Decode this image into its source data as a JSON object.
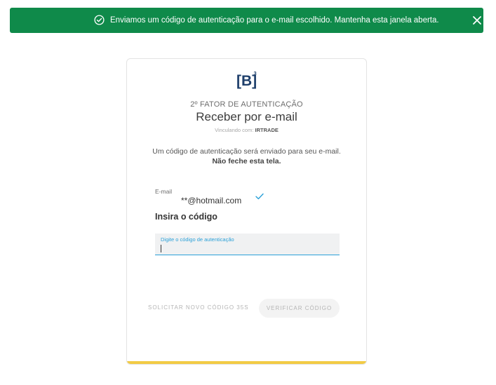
{
  "toast": {
    "message": "Enviamos um código de autenticação para o e-mail escolhido. Mantenha esta janela aberta.",
    "color": "#0f8a4a"
  },
  "logo": {
    "text": "[B]",
    "superscript": "3"
  },
  "header": {
    "subtitle": "2º FATOR DE AUTENTICAÇÃO",
    "title": "Receber por e-mail",
    "linking_prefix": "Vinculando com:",
    "linking_name": "IRTRADE"
  },
  "description": {
    "line1": "Um código de autenticação será enviado para seu e-mail.",
    "line2": "Não feche esta tela."
  },
  "email": {
    "label": "E-mail",
    "value": "**@hotmail.com"
  },
  "code": {
    "heading": "Insira o código",
    "field_label": "Digite o código de autenticação",
    "value": ""
  },
  "actions": {
    "resend_label": "SOLICITAR NOVO CÓDIGO 35S",
    "verify_label": "VERIFICAR CÓDIGO"
  },
  "colors": {
    "accent": "#2aa0d8",
    "footer_bar": "#f2cb45"
  }
}
